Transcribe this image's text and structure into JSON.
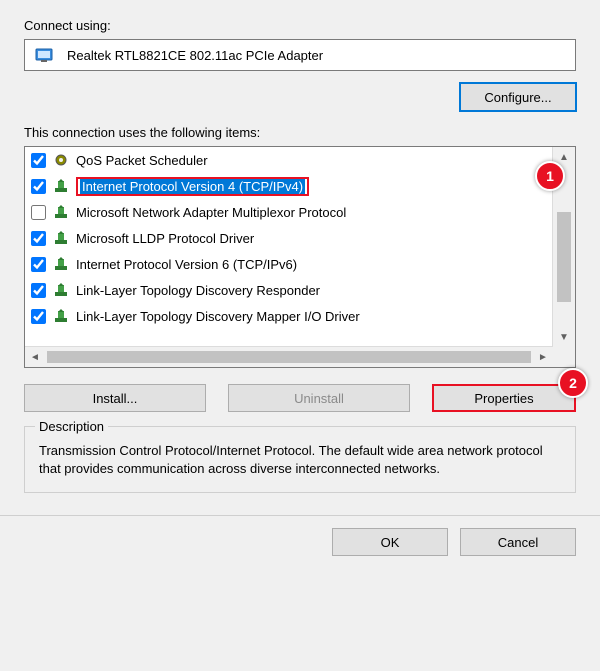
{
  "labels": {
    "connect_using": "Connect using:",
    "items_label": "This connection uses the following items:",
    "description_title": "Description"
  },
  "adapter": {
    "name": "Realtek RTL8821CE 802.11ac PCIe Adapter"
  },
  "buttons": {
    "configure": "Configure...",
    "install": "Install...",
    "uninstall": "Uninstall",
    "properties": "Properties",
    "ok": "OK",
    "cancel": "Cancel"
  },
  "items": [
    {
      "checked": true,
      "icon": "gear",
      "label": "QoS Packet Scheduler"
    },
    {
      "checked": true,
      "icon": "proto",
      "label": "Internet Protocol Version 4 (TCP/IPv4)",
      "selected": true
    },
    {
      "checked": false,
      "icon": "proto",
      "label": "Microsoft Network Adapter Multiplexor Protocol"
    },
    {
      "checked": true,
      "icon": "proto",
      "label": "Microsoft LLDP Protocol Driver"
    },
    {
      "checked": true,
      "icon": "proto",
      "label": "Internet Protocol Version 6 (TCP/IPv6)"
    },
    {
      "checked": true,
      "icon": "proto",
      "label": "Link-Layer Topology Discovery Responder"
    },
    {
      "checked": true,
      "icon": "proto",
      "label": "Link-Layer Topology Discovery Mapper I/O Driver"
    }
  ],
  "callouts": {
    "one": "1",
    "two": "2"
  },
  "description": "Transmission Control Protocol/Internet Protocol. The default wide area network protocol that provides communication across diverse interconnected networks."
}
